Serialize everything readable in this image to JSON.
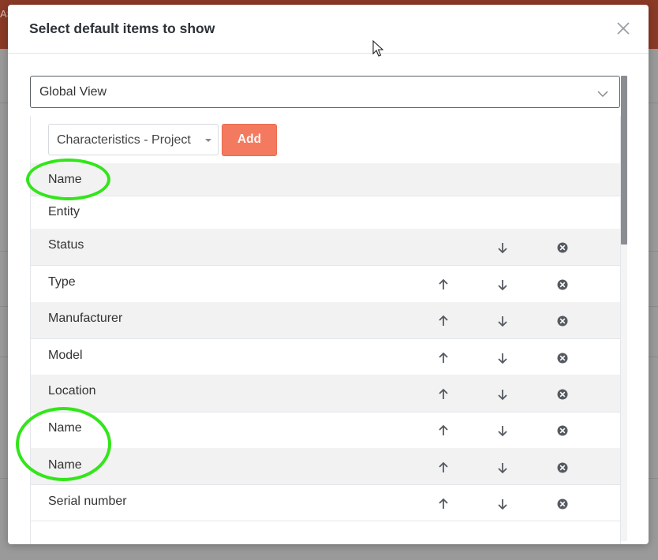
{
  "background": {
    "header_fragment": "AS"
  },
  "modal": {
    "title": "Select default items to show",
    "view_select": {
      "value": "Global View"
    },
    "characteristics_select": {
      "value": "Characteristics - Project"
    },
    "add_label": "Add",
    "rows": [
      {
        "label": "Name",
        "up": false,
        "down": false,
        "remove": false
      },
      {
        "label": "Entity",
        "up": false,
        "down": false,
        "remove": false
      },
      {
        "label": "Status",
        "up": false,
        "down": true,
        "remove": true
      },
      {
        "label": "Type",
        "up": true,
        "down": true,
        "remove": true
      },
      {
        "label": "Manufacturer",
        "up": true,
        "down": true,
        "remove": true
      },
      {
        "label": "Model",
        "up": true,
        "down": true,
        "remove": true
      },
      {
        "label": "Location",
        "up": true,
        "down": true,
        "remove": true
      },
      {
        "label": "Name",
        "up": true,
        "down": true,
        "remove": true
      },
      {
        "label": "Name",
        "up": true,
        "down": true,
        "remove": true
      },
      {
        "label": "Serial number",
        "up": true,
        "down": true,
        "remove": true
      }
    ]
  },
  "colors": {
    "accent": "#f47a5f",
    "annotation": "#33e51a"
  },
  "icons": {
    "close": "close-icon",
    "up": "arrow-up-icon",
    "down": "arrow-down-icon",
    "remove": "remove-circle-icon",
    "chevron": "chevron-down-icon"
  }
}
